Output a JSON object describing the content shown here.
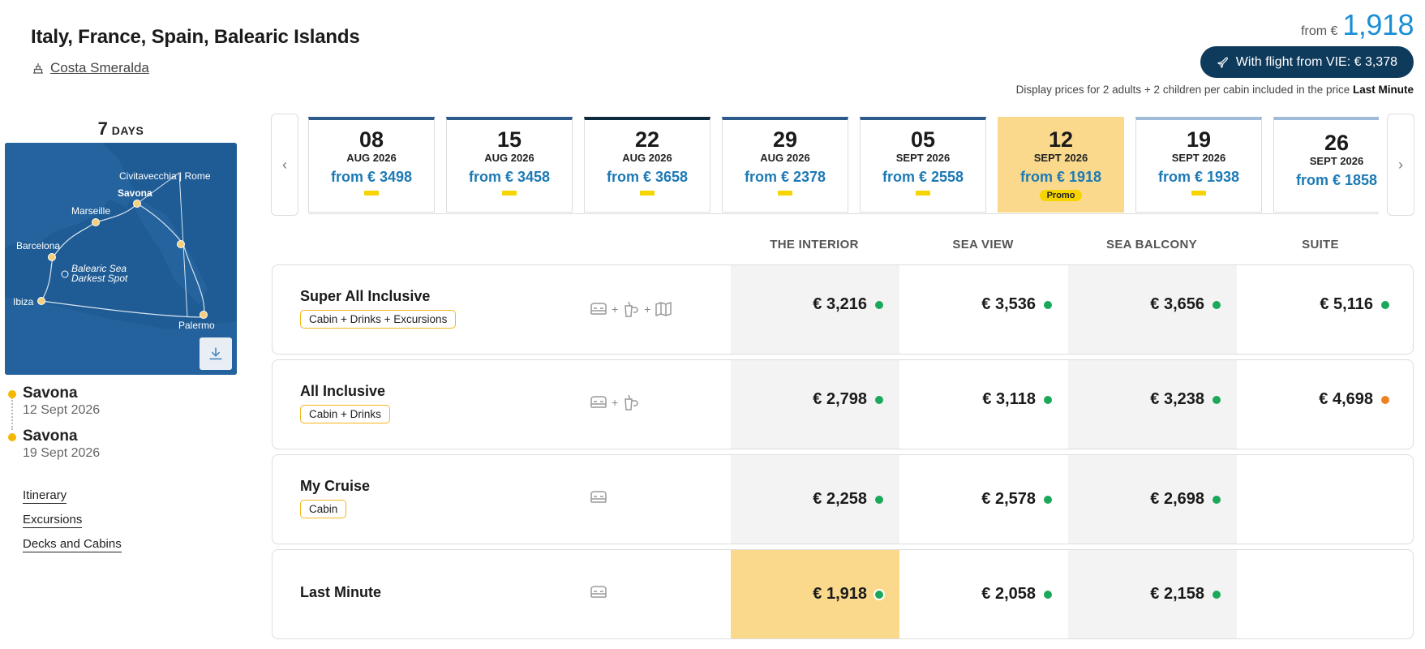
{
  "header": {
    "title": "Italy, France, Spain, Balearic Islands",
    "ship": "Costa Smeralda",
    "from_label": "from €",
    "from_price": "1,918",
    "flight_button": "With flight from VIE: € 3,378",
    "display_note_prefix": "Display prices for 2 adults + 2 children per cabin included in the price",
    "display_note_bold": "Last Minute"
  },
  "itinerary": {
    "days_number": "7",
    "days_label": "DAYS",
    "map_labels": {
      "civitavecchia": "Civitavecchia | Rome",
      "savona": "Savona",
      "marseille": "Marseille",
      "barcelona": "Barcelona",
      "balearic_1": "Balearic Sea",
      "balearic_2": "Darkest Spot",
      "ibiza": "Ibiza",
      "palermo": "Palermo"
    },
    "stops": [
      {
        "port": "Savona",
        "date": "12 Sept 2026"
      },
      {
        "port": "Savona",
        "date": "19 Sept 2026"
      }
    ],
    "links": [
      "Itinerary",
      "Excursions",
      "Decks and Cabins"
    ]
  },
  "dates": [
    {
      "day": "08",
      "month": "AUG 2026",
      "from": "from € 3498"
    },
    {
      "day": "15",
      "month": "AUG 2026",
      "from": "from € 3458"
    },
    {
      "day": "22",
      "month": "AUG 2026",
      "from": "from € 3658"
    },
    {
      "day": "29",
      "month": "AUG 2026",
      "from": "from € 2378"
    },
    {
      "day": "05",
      "month": "SEPT 2026",
      "from": "from € 2558"
    },
    {
      "day": "12",
      "month": "SEPT 2026",
      "from": "from € 1918",
      "promo": "Promo",
      "selected": true
    },
    {
      "day": "19",
      "month": "SEPT 2026",
      "from": "from € 1938"
    },
    {
      "day": "26",
      "month": "SEPT 2026",
      "from": "from € 1858"
    }
  ],
  "columns": [
    "THE INTERIOR",
    "SEA VIEW",
    "SEA BALCONY",
    "SUITE"
  ],
  "packages": [
    {
      "name": "Super All Inclusive",
      "tag": "Cabin + Drinks + Excursions",
      "prices": [
        "€ 3,216",
        "€ 3,536",
        "€ 3,656",
        "€ 5,116"
      ],
      "status": [
        "green",
        "green",
        "green",
        "green"
      ]
    },
    {
      "name": "All Inclusive",
      "tag": "Cabin + Drinks",
      "prices": [
        "€ 2,798",
        "€ 3,118",
        "€ 3,238",
        "€ 4,698"
      ],
      "status": [
        "green",
        "green",
        "green",
        "orange"
      ]
    },
    {
      "name": "My Cruise",
      "tag": "Cabin",
      "prices": [
        "€ 2,258",
        "€ 2,578",
        "€ 2,698",
        ""
      ],
      "status": [
        "green",
        "green",
        "green",
        ""
      ]
    },
    {
      "name": "Last Minute",
      "tag": "",
      "prices": [
        "€ 1,918",
        "€ 2,058",
        "€ 2,158",
        ""
      ],
      "status": [
        "green",
        "green",
        "green",
        ""
      ]
    }
  ],
  "colors": {
    "accent_blue": "#1a8fd6",
    "flight_button_bg": "#0e3a5b",
    "highlight": "#fad98c",
    "available": "#1aa85a",
    "limited": "#f08020"
  }
}
